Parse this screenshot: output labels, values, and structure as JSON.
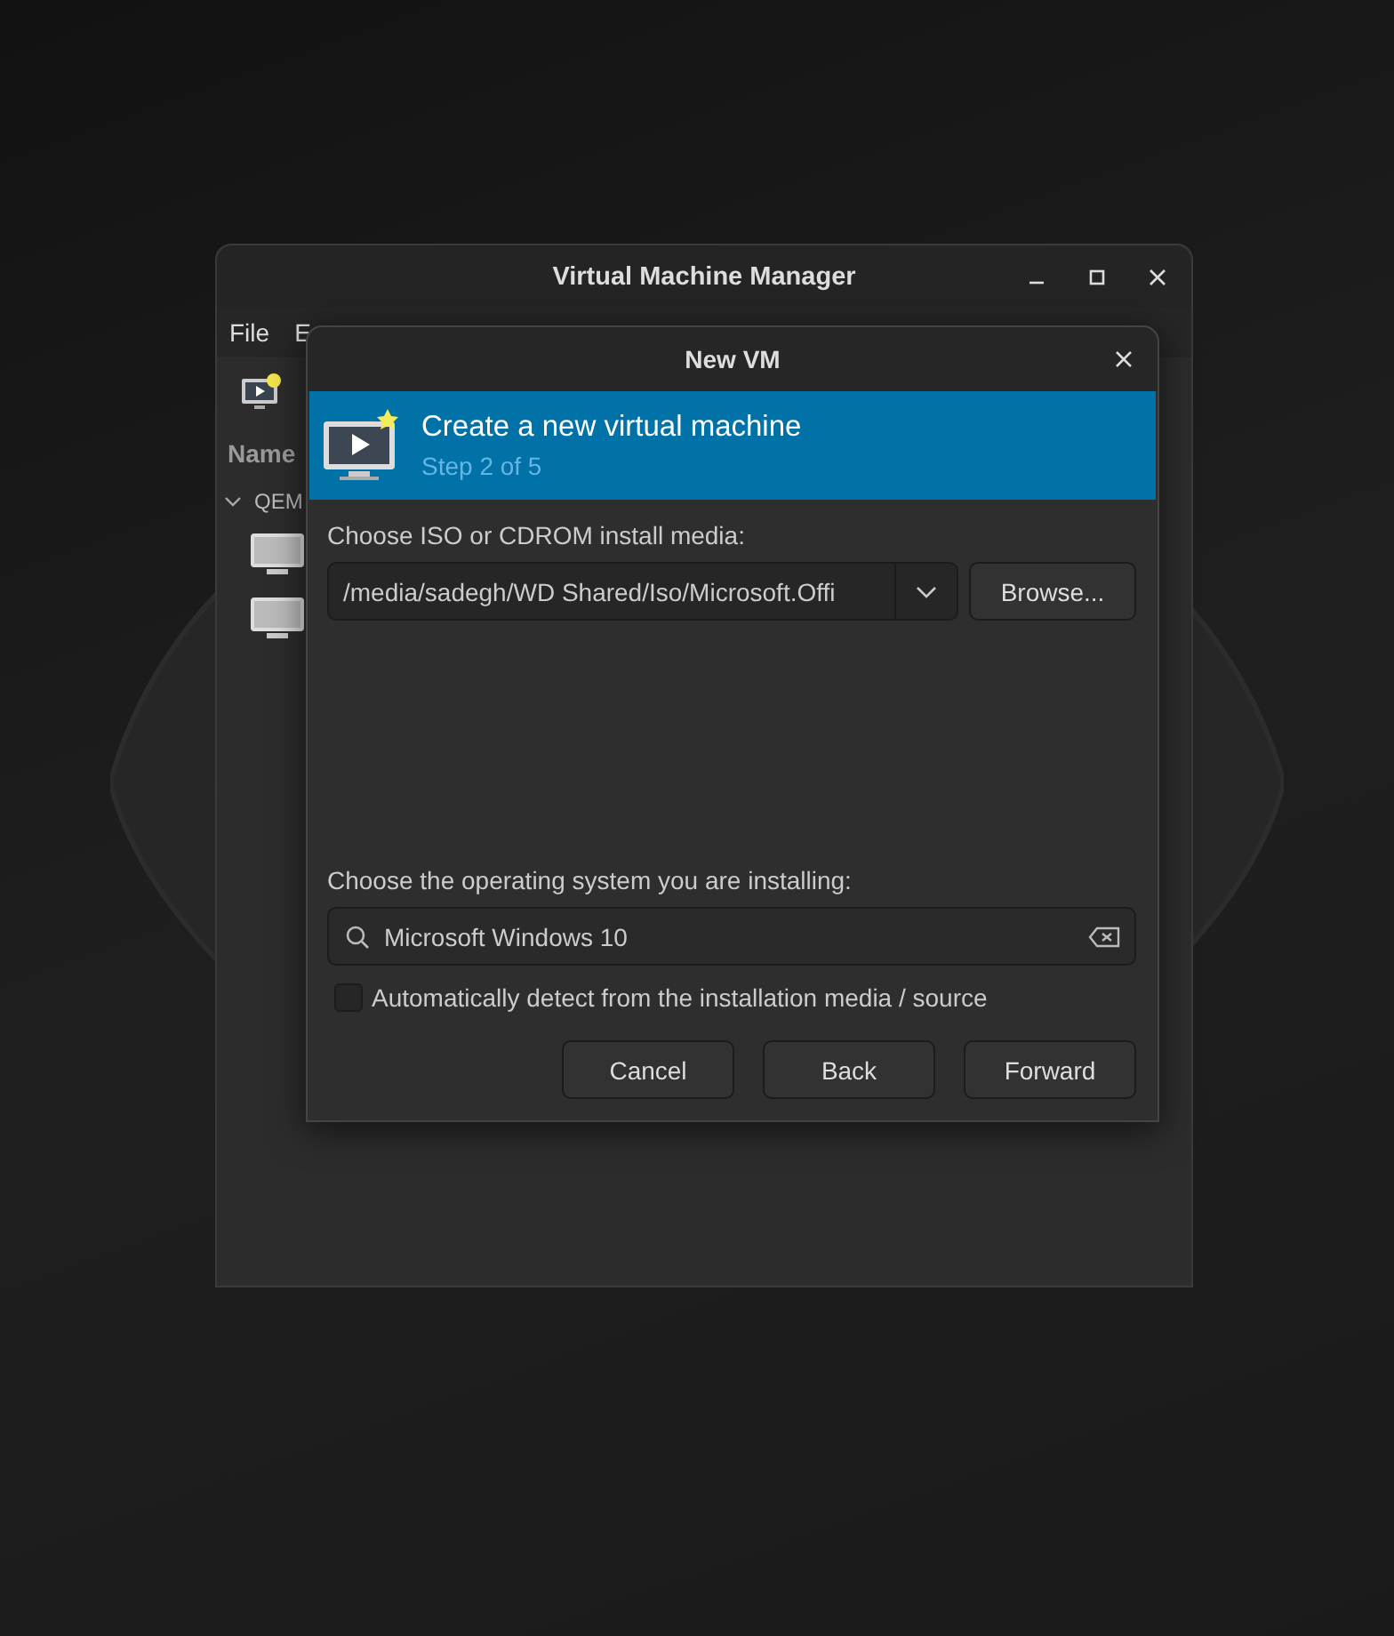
{
  "main_window": {
    "title": "Virtual Machine Manager",
    "menu": [
      "File",
      "E"
    ],
    "list_header": "Name",
    "group": {
      "label": "QEM",
      "expanded": true
    }
  },
  "dialog": {
    "title": "New VM",
    "header": {
      "title": "Create a new virtual machine",
      "subtitle": "Step 2 of 5"
    },
    "media_label": "Choose ISO or CDROM install media:",
    "media_value": "/media/sadegh/WD Shared/Iso/Microsoft.Offi",
    "browse_button": "Browse...",
    "os_label": "Choose the operating system you are installing:",
    "os_search": {
      "value": "Microsoft Windows 10"
    },
    "auto_detect": {
      "label": "Automatically detect from the installation media / source",
      "checked": false
    },
    "buttons": [
      "Cancel",
      "Back",
      "Forward"
    ]
  }
}
